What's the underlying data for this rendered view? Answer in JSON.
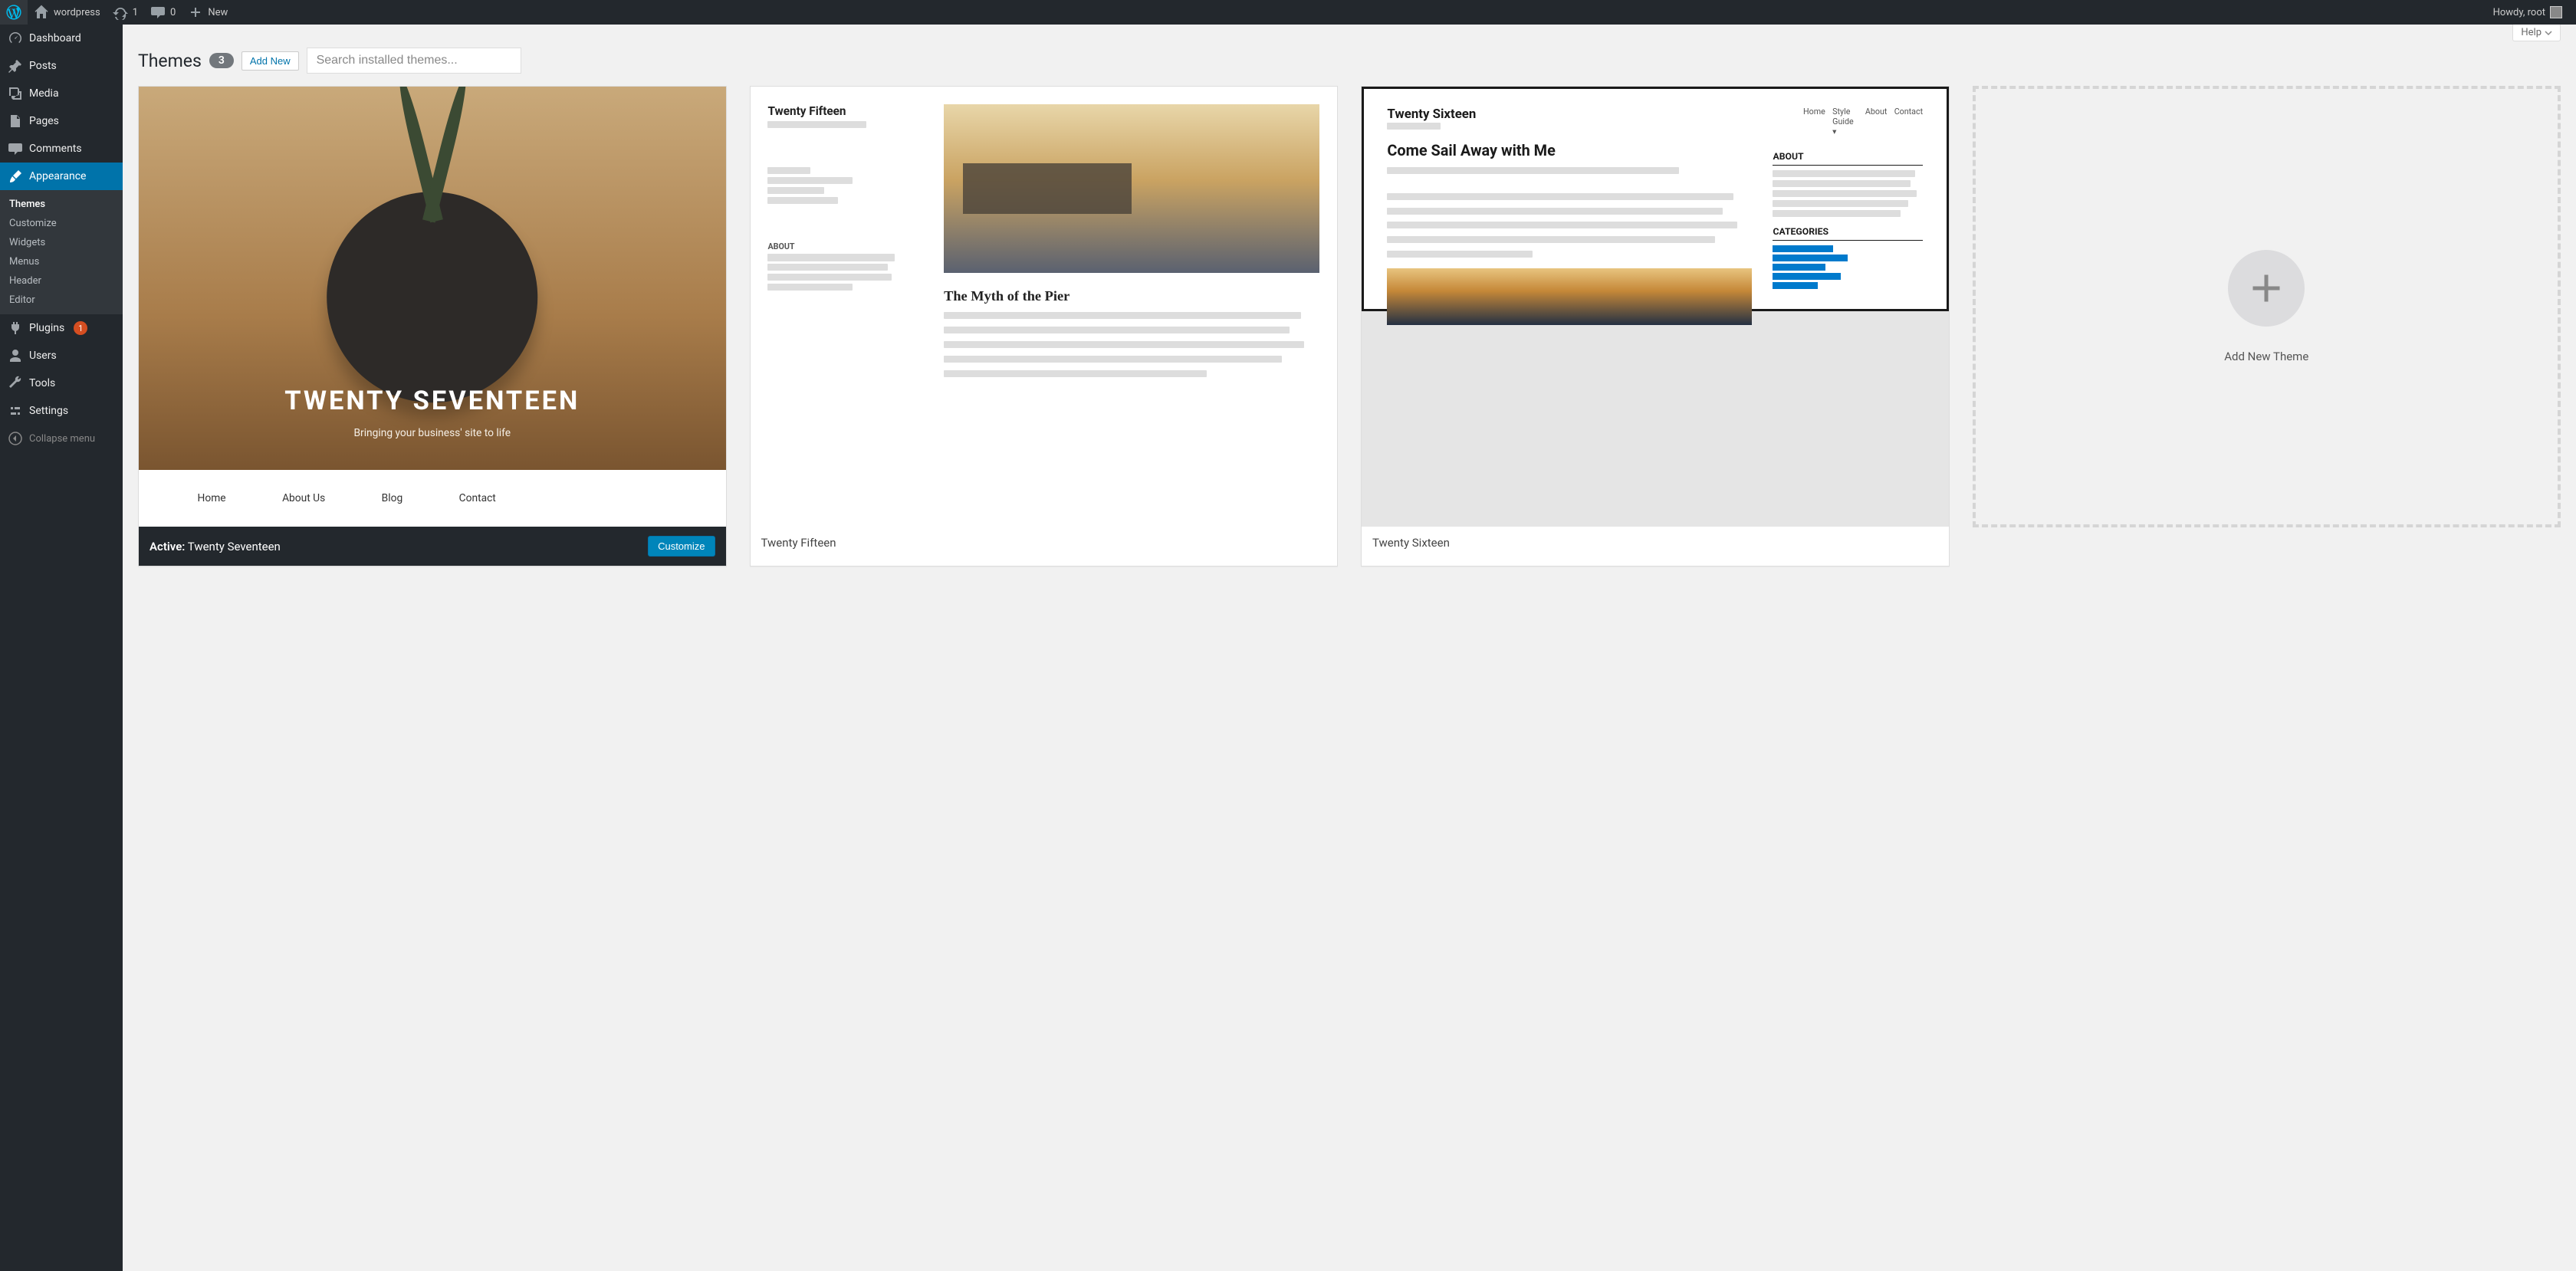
{
  "adminbar": {
    "site_name": "wordpress",
    "updates_count": "1",
    "comments_count": "0",
    "new_label": "New",
    "howdy": "Howdy, root"
  },
  "sidebar": {
    "dashboard": "Dashboard",
    "posts": "Posts",
    "media": "Media",
    "pages": "Pages",
    "comments": "Comments",
    "appearance": "Appearance",
    "plugins": "Plugins",
    "plugins_count": "1",
    "users": "Users",
    "tools": "Tools",
    "settings": "Settings",
    "collapse": "Collapse menu",
    "submenu": {
      "themes": "Themes",
      "customize": "Customize",
      "widgets": "Widgets",
      "menus": "Menus",
      "header": "Header",
      "editor": "Editor"
    }
  },
  "screen": {
    "help": "Help"
  },
  "heading": {
    "title": "Themes",
    "count": "3",
    "add_new": "Add New",
    "search_placeholder": "Search installed themes..."
  },
  "themes": {
    "active_prefix": "Active:",
    "customize_btn": "Customize",
    "items": [
      {
        "name": "Twenty Seventeen",
        "active": true
      },
      {
        "name": "Twenty Fifteen",
        "active": false
      },
      {
        "name": "Twenty Sixteen",
        "active": false
      }
    ],
    "add_new_theme": "Add New Theme",
    "shot2017": {
      "title": "TWENTY SEVENTEEN",
      "tagline": "Bringing your business' site to life",
      "nav_home": "Home",
      "nav_about": "About Us",
      "nav_blog": "Blog",
      "nav_contact": "Contact"
    },
    "shot2015": {
      "title": "Twenty Fifteen",
      "about": "ABOUT",
      "post": "The Myth of the Pier"
    },
    "shot2016": {
      "brand": "Twenty Sixteen",
      "post": "Come Sail Away with Me",
      "about": "ABOUT",
      "categories": "CATEGORIES"
    }
  }
}
